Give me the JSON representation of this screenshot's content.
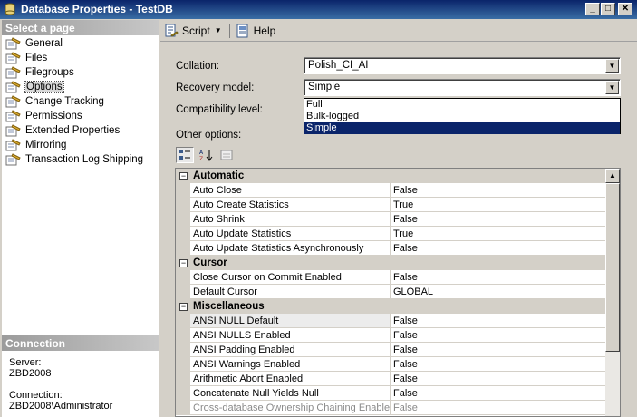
{
  "window": {
    "title": "Database Properties - TestDB",
    "min_label": "_",
    "max_label": "□",
    "close_label": "✕"
  },
  "left": {
    "select_header": "Select a page",
    "pages": [
      {
        "label": "General",
        "icon": "page-properties-icon"
      },
      {
        "label": "Files",
        "icon": "page-properties-icon"
      },
      {
        "label": "Filegroups",
        "icon": "page-properties-icon"
      },
      {
        "label": "Options",
        "icon": "page-properties-icon",
        "selected": true
      },
      {
        "label": "Change Tracking",
        "icon": "page-properties-icon"
      },
      {
        "label": "Permissions",
        "icon": "page-properties-icon"
      },
      {
        "label": "Extended Properties",
        "icon": "page-properties-icon"
      },
      {
        "label": "Mirroring",
        "icon": "page-properties-icon"
      },
      {
        "label": "Transaction Log Shipping",
        "icon": "page-properties-icon"
      }
    ],
    "connection_header": "Connection",
    "server_label": "Server:",
    "server_value": "ZBD2008",
    "connection_label": "Connection:",
    "connection_value": "ZBD2008\\Administrator"
  },
  "toolbar": {
    "script_label": "Script",
    "help_label": "Help"
  },
  "form": {
    "collation_label": "Collation:",
    "collation_value": "Polish_CI_AI",
    "recovery_label": "Recovery model:",
    "recovery_value": "Simple",
    "compat_label": "Compatibility level:",
    "recovery_options": [
      "Full",
      "Bulk-logged",
      "Simple"
    ],
    "other_options_label": "Other options:"
  },
  "grid": {
    "categories": [
      {
        "name": "Automatic",
        "rows": [
          {
            "name": "Auto Close",
            "value": "False"
          },
          {
            "name": "Auto Create Statistics",
            "value": "True"
          },
          {
            "name": "Auto Shrink",
            "value": "False"
          },
          {
            "name": "Auto Update Statistics",
            "value": "True"
          },
          {
            "name": "Auto Update Statistics Asynchronously",
            "value": "False"
          }
        ]
      },
      {
        "name": "Cursor",
        "rows": [
          {
            "name": "Close Cursor on Commit Enabled",
            "value": "False"
          },
          {
            "name": "Default Cursor",
            "value": "GLOBAL"
          }
        ]
      },
      {
        "name": "Miscellaneous",
        "rows": [
          {
            "name": "ANSI NULL Default",
            "value": "False"
          },
          {
            "name": "ANSI NULLS Enabled",
            "value": "False"
          },
          {
            "name": "ANSI Padding Enabled",
            "value": "False"
          },
          {
            "name": "ANSI Warnings Enabled",
            "value": "False"
          },
          {
            "name": "Arithmetic Abort Enabled",
            "value": "False"
          },
          {
            "name": "Concatenate Null Yields Null",
            "value": "False"
          },
          {
            "name": "Cross-database Ownership Chaining Enabled",
            "value": "False",
            "dim": true
          }
        ]
      }
    ]
  }
}
